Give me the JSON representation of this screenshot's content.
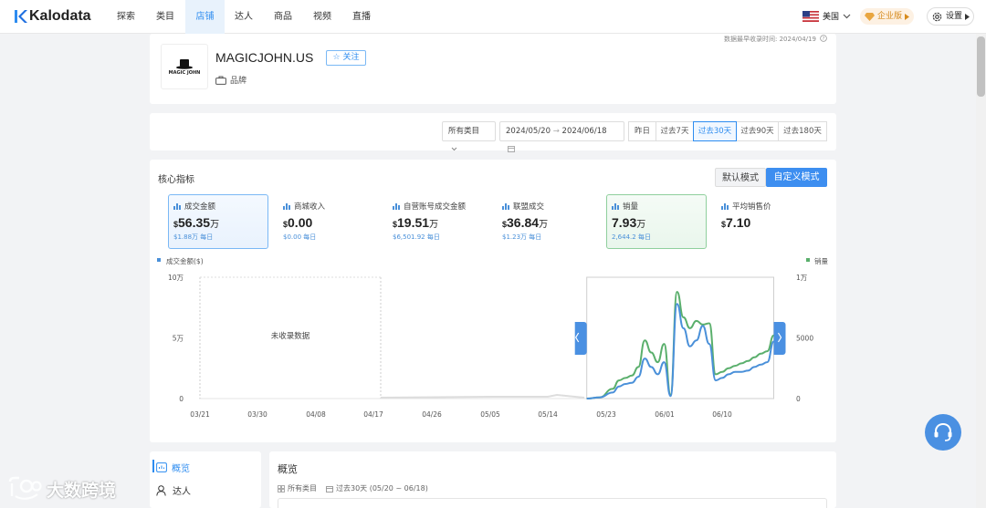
{
  "brand": {
    "name": "Kalodata"
  },
  "nav": [
    {
      "label": "探索"
    },
    {
      "label": "类目"
    },
    {
      "label": "店铺"
    },
    {
      "label": "达人"
    },
    {
      "label": "商品"
    },
    {
      "label": "视频"
    },
    {
      "label": "直播"
    }
  ],
  "nav_active_index": 2,
  "header_right": {
    "region": "美国",
    "enterprise": "企业版",
    "settings": "设置"
  },
  "shop": {
    "update_time": "数据最早收录时间: 2024/04/19",
    "logo_text_top": "MAGIC",
    "logo_text_bottom": "JOHN",
    "name": "MAGICJOHN.US",
    "follow": "关注",
    "tag": "品牌"
  },
  "filters": {
    "category": "所有类目",
    "date_start": "2024/05/20",
    "date_arrow": "→",
    "date_end": "2024/06/18",
    "ranges": [
      {
        "label": "昨日",
        "active": false
      },
      {
        "label": "过去7天",
        "active": false
      },
      {
        "label": "过去30天",
        "active": true
      },
      {
        "label": "过去90天",
        "active": false
      },
      {
        "label": "过去180天",
        "active": false
      }
    ]
  },
  "core": {
    "title": "核心指标",
    "mode_default": "默认模式",
    "mode_custom": "自定义模式",
    "metrics": [
      {
        "label": "成交金额",
        "currency": "$",
        "value": "56.35",
        "unit": "万",
        "sub": "$1.88万 每日",
        "selected": "blue"
      },
      {
        "label": "商城收入",
        "currency": "$",
        "value": "0.00",
        "unit": "",
        "sub": "$0.00 每日",
        "selected": ""
      },
      {
        "label": "自营账号成交金额",
        "currency": "$",
        "value": "19.51",
        "unit": "万",
        "sub": "$6,501.92 每日",
        "selected": ""
      },
      {
        "label": "联盟成交",
        "currency": "$",
        "value": "36.84",
        "unit": "万",
        "sub": "$1.23万 每日",
        "selected": ""
      },
      {
        "label": "销量",
        "currency": "",
        "value": "7.93",
        "unit": "万",
        "sub": "2,644.2 每日",
        "selected": "green"
      },
      {
        "label": "平均销售价",
        "currency": "$",
        "value": "7.10",
        "unit": "",
        "sub": "",
        "selected": ""
      }
    ]
  },
  "chart_data": {
    "type": "line",
    "legend_left": "成交金额($)",
    "legend_right": "销量",
    "no_data_text": "未收录数据",
    "x_labels": [
      "03/21",
      "03/30",
      "04/08",
      "04/17",
      "04/26",
      "05/05",
      "05/14",
      "05/23",
      "06/01",
      "06/10"
    ],
    "y_left": {
      "ticks": [
        "10万",
        "5万",
        "0"
      ],
      "range": [
        0,
        100000
      ]
    },
    "y_right": {
      "ticks": [
        "1万",
        "5000",
        "0"
      ],
      "range": [
        0,
        10000
      ]
    },
    "colors": {
      "gmv": "#4a90d9",
      "units": "#5aaf6c"
    },
    "series": [
      {
        "name": "成交金额($)",
        "color": "#4a90d9",
        "x": [
          "05/20",
          "05/22",
          "05/24",
          "05/25",
          "05/26",
          "05/27",
          "05/28",
          "05/29",
          "05/30",
          "05/31",
          "06/01",
          "06/02",
          "06/03",
          "06/04",
          "06/05",
          "06/06",
          "06/07",
          "06/08",
          "06/09",
          "06/10",
          "06/11",
          "06/12",
          "06/13",
          "06/14",
          "06/15",
          "06/16",
          "06/17",
          "06/18"
        ],
        "values": [
          0,
          1000,
          5000,
          10000,
          12000,
          13000,
          18000,
          33000,
          26000,
          20000,
          30000,
          2000,
          78000,
          58000,
          43000,
          48000,
          60000,
          45000,
          15000,
          17000,
          20000,
          22000,
          22000,
          23000,
          26000,
          28000,
          30000,
          47000
        ]
      },
      {
        "name": "销量",
        "color": "#5aaf6c",
        "x": [
          "05/20",
          "05/22",
          "05/24",
          "05/25",
          "05/26",
          "05/27",
          "05/28",
          "05/29",
          "05/30",
          "05/31",
          "06/01",
          "06/02",
          "06/03",
          "06/04",
          "06/05",
          "06/06",
          "06/07",
          "06/08",
          "06/09",
          "06/10",
          "06/11",
          "06/12",
          "06/13",
          "06/14",
          "06/15",
          "06/16",
          "06/17",
          "06/18"
        ],
        "values": [
          0,
          100,
          800,
          1500,
          1700,
          1900,
          2600,
          4800,
          3800,
          3000,
          4500,
          300,
          8800,
          6700,
          5800,
          6400,
          6100,
          6200,
          2000,
          2200,
          2500,
          2700,
          2900,
          3100,
          3400,
          3700,
          3900,
          5200
        ]
      }
    ]
  },
  "sidebar": [
    {
      "label": "概览",
      "active": true
    },
    {
      "label": "达人",
      "active": false
    }
  ],
  "overview": {
    "title": "概览",
    "category": "所有类目",
    "range": "过去30天 (05/20 ~ 06/18)"
  },
  "watermark": "大数跨境"
}
